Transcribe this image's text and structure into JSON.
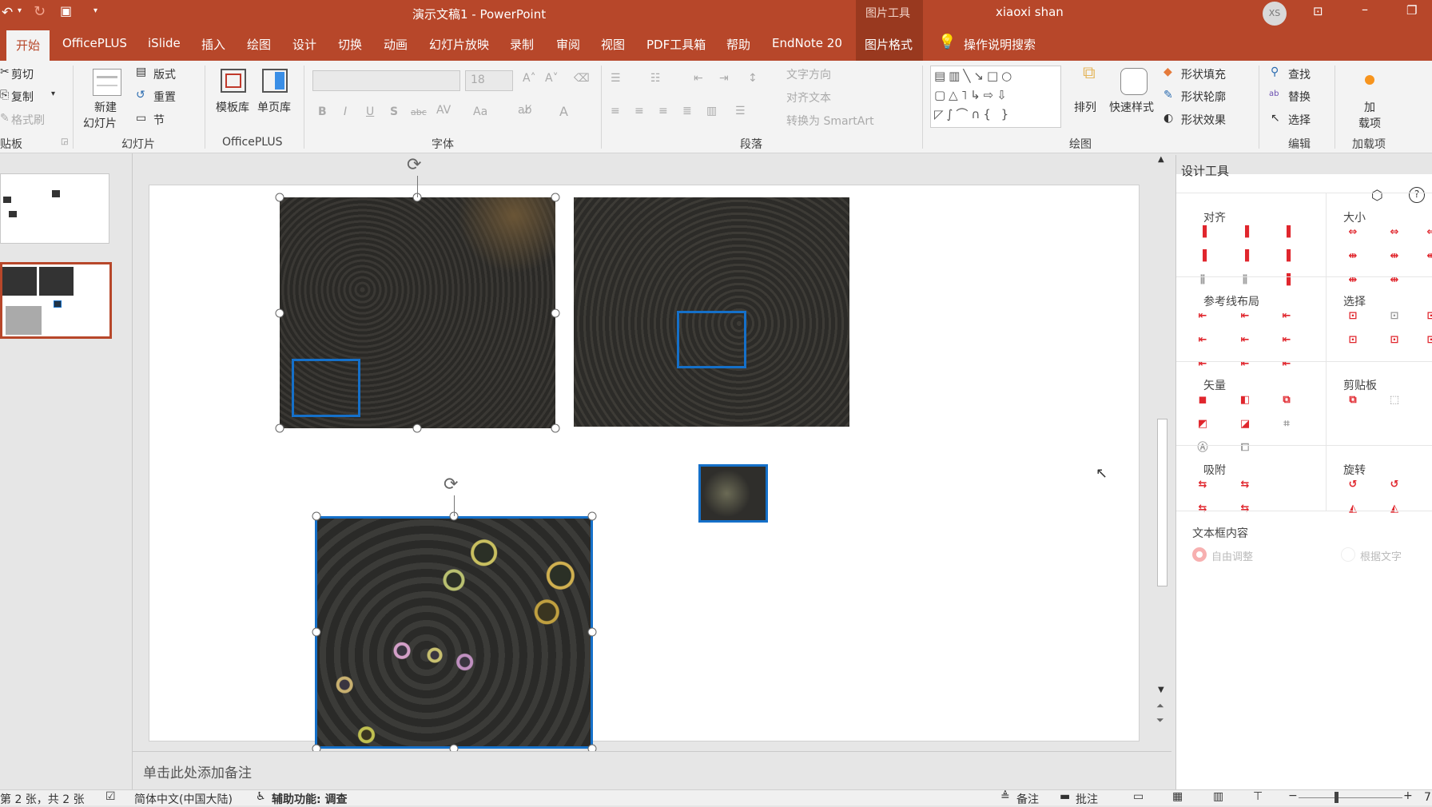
{
  "window": {
    "title": "演示文稿1  -  PowerPoint",
    "context_tab_group": "图片工具",
    "user_name": "xiaoxi shan",
    "user_initials": "XS"
  },
  "tabs": [
    "开始",
    "OfficePLUS",
    "iSlide",
    "插入",
    "绘图",
    "设计",
    "切换",
    "动画",
    "幻灯片放映",
    "录制",
    "审阅",
    "视图",
    "PDF工具箱",
    "帮助",
    "EndNote 20",
    "图片格式"
  ],
  "active_tab": "开始",
  "tell_me": "操作说明搜索",
  "ribbon": {
    "clipboard": {
      "label": "贴板",
      "cut": "剪切",
      "copy": "复制",
      "format_painter": "格式刷"
    },
    "slides": {
      "label": "幻灯片",
      "new_slide_1": "新建",
      "new_slide_2": "幻灯片",
      "layout": "版式",
      "reset": "重置",
      "section": "节"
    },
    "officeplus": {
      "label": "OfficePLUS",
      "templates": "模板库",
      "single_page": "单页库"
    },
    "font": {
      "label": "字体",
      "font_name": "",
      "font_size": "18"
    },
    "paragraph": {
      "label": "段落",
      "text_direction": "文字方向",
      "align_text": "对齐文本",
      "smartart": "转换为 SmartArt"
    },
    "drawing": {
      "label": "绘图",
      "arrange": "排列",
      "quick_styles": "快速样式",
      "shape_fill": "形状填充",
      "shape_outline": "形状轮廓",
      "shape_effects": "形状效果"
    },
    "editing": {
      "label": "编辑",
      "find": "查找",
      "replace": "替换",
      "select": "选择"
    },
    "addins": {
      "label": "加载项",
      "addin_1": "加",
      "addin_2": "载项"
    }
  },
  "notes_placeholder": "单击此处添加备注",
  "status": {
    "slide_info": "第 2 张，共 2 张",
    "language": "简体中文(中国大陆)",
    "accessibility": "辅助功能: 调查",
    "notes": "备注",
    "comments": "批注",
    "zoom": "7"
  },
  "design_panel": {
    "title": "设计工具",
    "sections": [
      {
        "title": "对齐",
        "icons": [
          "align-left",
          "align-center",
          "align-right",
          "align-top",
          "align-middle",
          "align-bottom",
          "distribute-horizontal",
          "distribute-vertical",
          "align-diagonal"
        ]
      },
      {
        "title": "大小",
        "icons": [
          "same-width",
          "same-height",
          "same-size",
          "stretch-left",
          "stretch-right",
          "stretch-all",
          "stretch-top",
          "stretch-bottom"
        ]
      },
      {
        "title": "参考线布局",
        "icons": [
          "guide-left",
          "guide-center-h",
          "guide-right",
          "guide-top",
          "guide-center-v",
          "guide-bottom",
          "guide-fill-width",
          "guide-fill-height",
          "guide-fill"
        ]
      },
      {
        "title": "选择",
        "icons": [
          "select-same",
          "select-similar",
          "select-other",
          "select-top",
          "select-middle",
          "select-bottom"
        ]
      },
      {
        "title": "矢量",
        "icons": [
          "union",
          "combine",
          "fragment",
          "intersect",
          "subtract",
          "crop-shape",
          "text-to-shape",
          "shape-outline"
        ]
      },
      {
        "title": "剪贴板",
        "icons": [
          "copy-shape",
          "paste-in-place"
        ]
      },
      {
        "title": "吸附",
        "icons": [
          "snap-left",
          "snap-right",
          "snap-top",
          "snap-bottom"
        ]
      },
      {
        "title": "旋转",
        "icons": [
          "rotate-left",
          "rotate-right",
          "flip-horizontal",
          "flip-vertical"
        ]
      }
    ],
    "textbox": {
      "title": "文本框内容",
      "option_free": "自由调整",
      "option_text": "根据文字"
    }
  },
  "colors": {
    "accent": "#b7472a",
    "selection": "#1570c9",
    "tool_red": "#e0262d"
  }
}
